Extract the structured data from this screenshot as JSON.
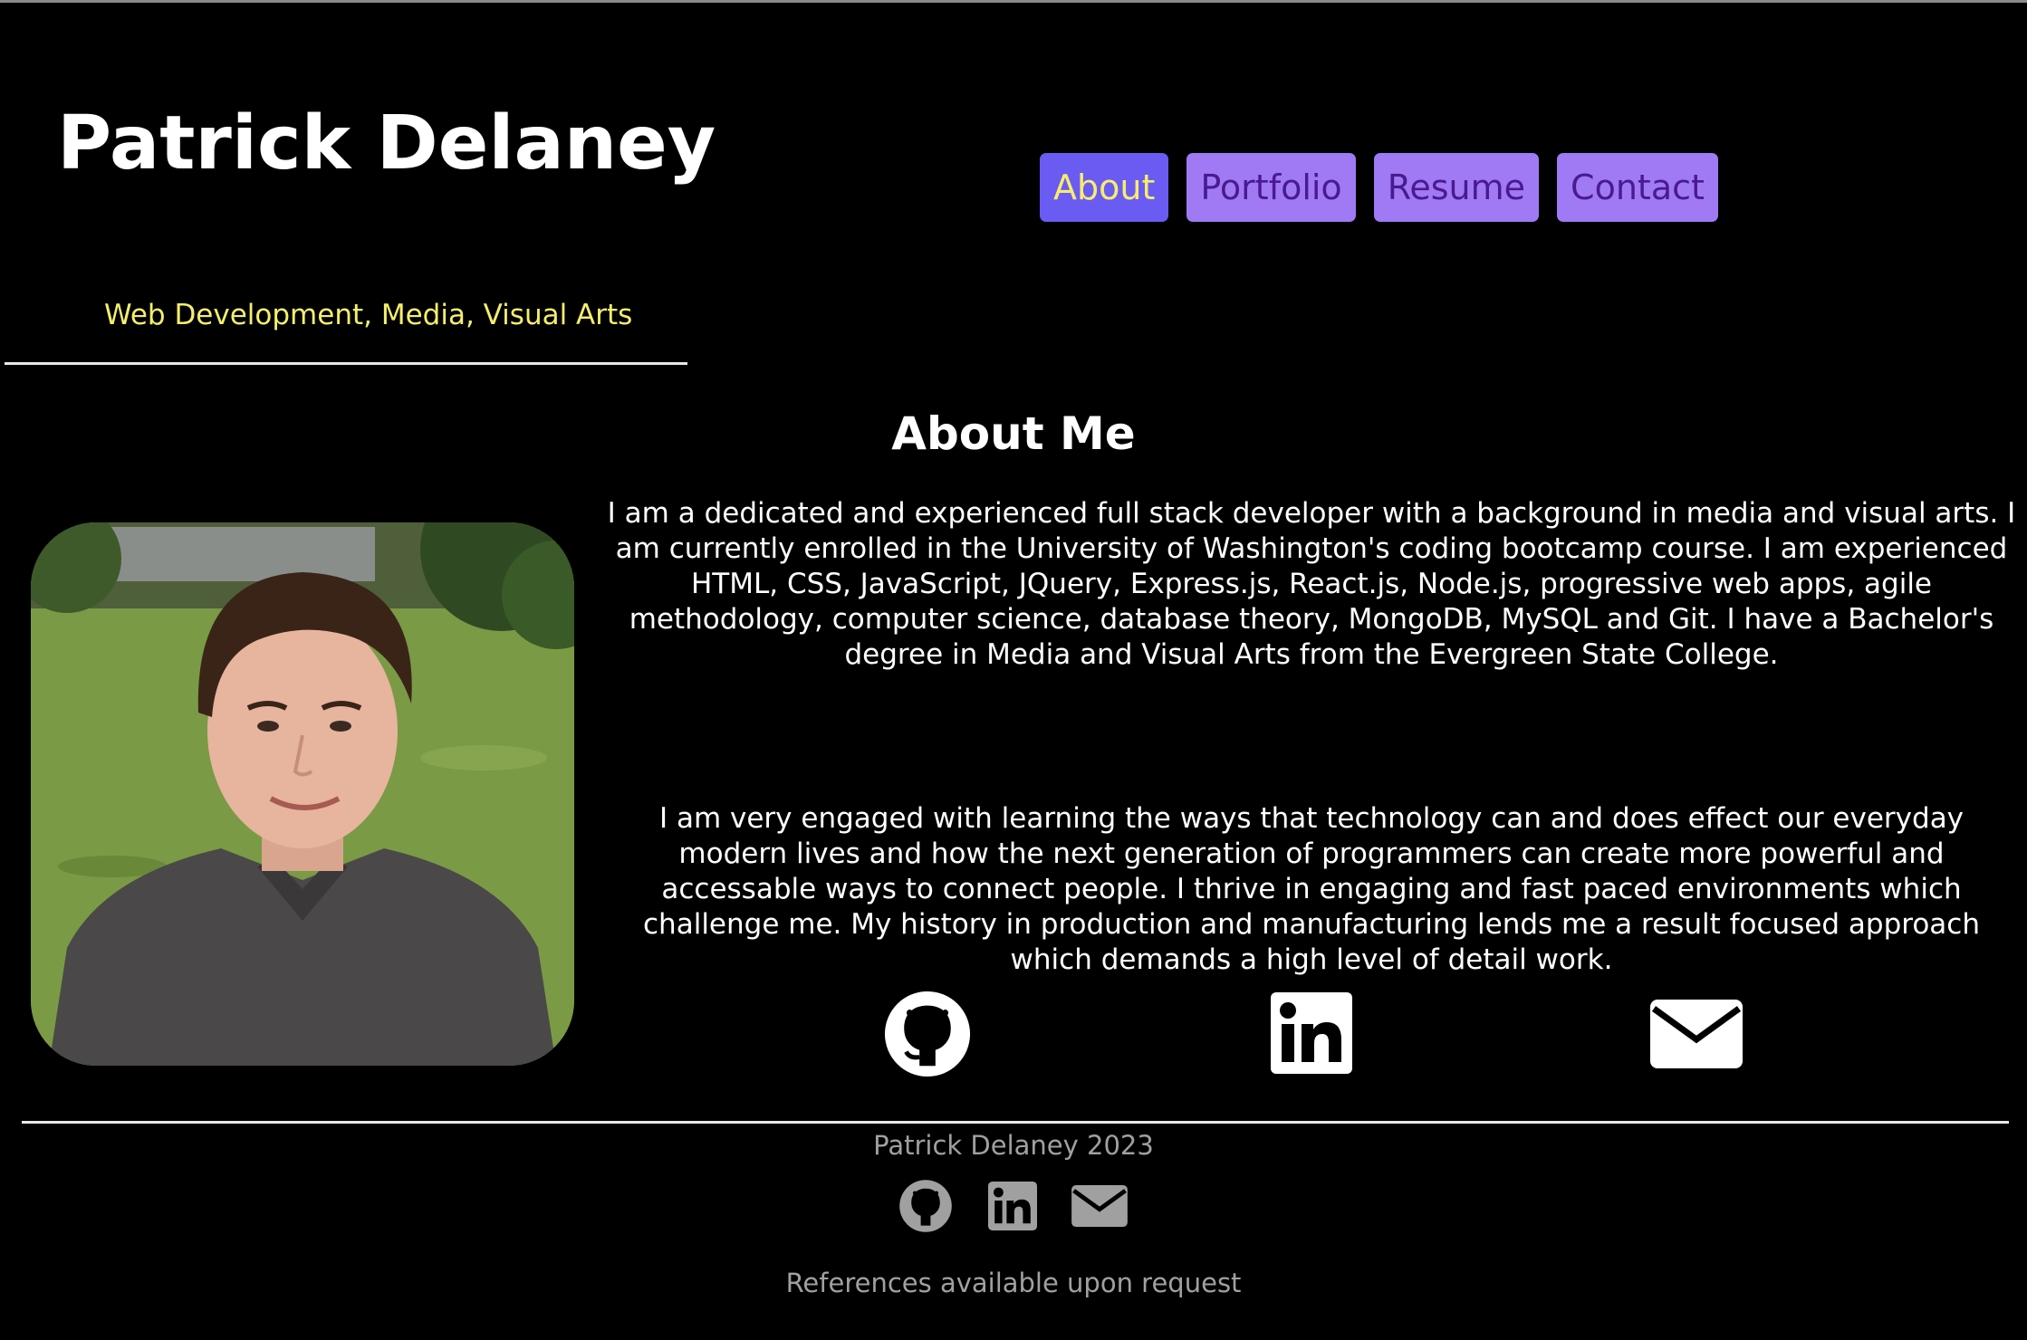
{
  "header": {
    "name": "Patrick Delaney",
    "tagline": "Web Development, Media, Visual Arts"
  },
  "nav": {
    "items": [
      {
        "label": "About",
        "active": true
      },
      {
        "label": "Portfolio",
        "active": false
      },
      {
        "label": "Resume",
        "active": false
      },
      {
        "label": "Contact",
        "active": false
      }
    ]
  },
  "about": {
    "title": "About Me",
    "paragraph_1": "I am a dedicated and experienced full stack developer with a background in media and visual arts. I am currently enrolled in the University of Washington's coding bootcamp course. I am experienced HTML, CSS, JavaScript, JQuery, Express.js, React.js, Node.js, progressive web apps, agile methodology, computer science, database theory, MongoDB, MySQL and Git. I have a Bachelor's degree in Media and Visual Arts from the Evergreen State College.",
    "paragraph_2": "I am very engaged with learning the ways that technology can and does effect our everyday modern lives and how the next generation of programmers can create more powerful and accessable ways to connect people. I thrive in engaging and fast paced environments which challenge me. My history in production and manufacturing lends me a result focused approach which demands a high level of detail work.",
    "social_icons": [
      "github-icon",
      "linkedin-icon",
      "envelope-icon"
    ]
  },
  "footer": {
    "copyright": "Patrick Delaney 2023",
    "social_icons": [
      "github-icon",
      "linkedin-icon",
      "envelope-icon"
    ],
    "note": "References available upon request"
  },
  "colors": {
    "background": "#000000",
    "accent_yellow": "#f5ee6b",
    "nav_button": "#a07af5",
    "nav_button_active": "#6a5bf2",
    "nav_text": "#4a1a8e",
    "footer_text": "#a0a0a0"
  }
}
